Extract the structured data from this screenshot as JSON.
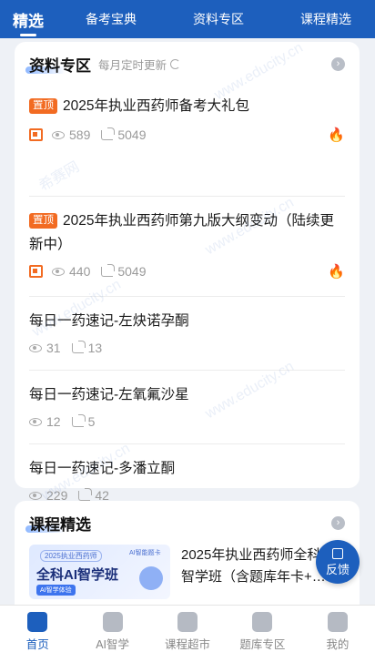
{
  "topnav": {
    "tabs": [
      {
        "label": "精选"
      },
      {
        "label": "备考宝典"
      },
      {
        "label": "资料专区"
      },
      {
        "label": "课程精选"
      }
    ]
  },
  "materials": {
    "title": "资料专区",
    "subtitle": "每月定时更新",
    "more_icon": "›",
    "items": [
      {
        "tag": "置顶",
        "title": "2025年执业西药师备考大礼包",
        "views": "589",
        "shares": "5049",
        "group_icon": "团",
        "fire_icon": "🔥"
      },
      {
        "tag": "置顶",
        "title": "2025年执业西药师第九版大纲变动（陆续更新中）",
        "views": "440",
        "shares": "5049",
        "group_icon": "团",
        "fire_icon": "🔥"
      },
      {
        "title": "每日一药速记-左炔诺孕酮",
        "views": "31",
        "shares": "13"
      },
      {
        "title": "每日一药速记-左氧氟沙星",
        "views": "12",
        "shares": "5"
      },
      {
        "title": "每日一药速记-多潘立酮",
        "views": "229",
        "shares": "42"
      }
    ]
  },
  "courses": {
    "title": "课程精选",
    "more_icon": "›",
    "item": {
      "banner_top": "2025执业西药师",
      "banner_tag": "AI智能题卡",
      "banner_main": "全科AI智学班",
      "banner_sub": "AI智学体验",
      "title": "2025年执业西药师全科AI智学班（含题库年卡+…"
    }
  },
  "feedback": {
    "label": "反馈"
  },
  "bottomnav": {
    "items": [
      {
        "label": "首页"
      },
      {
        "label": "AI智学"
      },
      {
        "label": "课程超市"
      },
      {
        "label": "题库专区"
      },
      {
        "label": "我的"
      }
    ]
  },
  "watermark": {
    "site": "www.educity.cn",
    "brand": "希赛网"
  },
  "colors": {
    "primary": "#1d5fbd",
    "accent": "#f26b22",
    "fire": "#f2481d"
  }
}
